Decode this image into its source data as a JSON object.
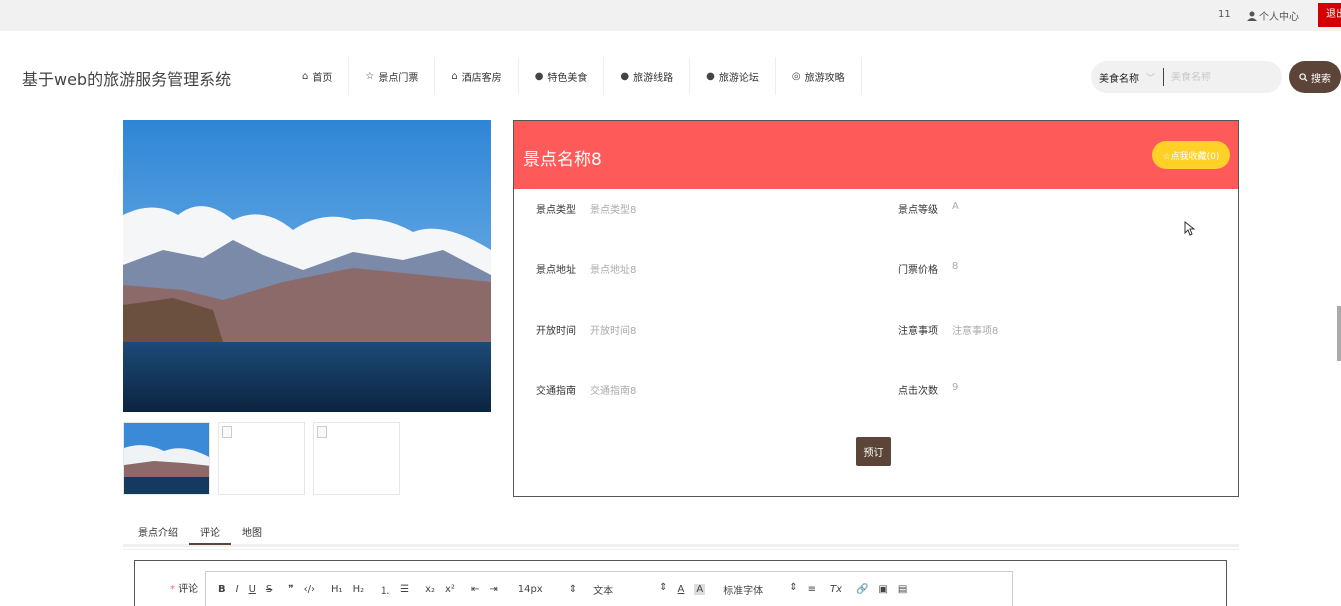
{
  "topbar": {
    "count": "11",
    "user_center": "个人中心",
    "logout": "退出"
  },
  "header": {
    "logo": "基于web的旅游服务管理系统",
    "nav": [
      {
        "label": "首页",
        "icon": "home-icon",
        "glyph": "⌂"
      },
      {
        "label": "景点门票",
        "icon": "star-icon",
        "glyph": "☆"
      },
      {
        "label": "酒店客房",
        "icon": "bag-icon",
        "glyph": "⌂"
      },
      {
        "label": "特色美食",
        "icon": "info-icon",
        "glyph": "●"
      },
      {
        "label": "旅游线路",
        "icon": "question-icon",
        "glyph": "●"
      },
      {
        "label": "旅游论坛",
        "icon": "info-icon",
        "glyph": "●"
      },
      {
        "label": "旅游攻略",
        "icon": "globe-icon",
        "glyph": "◎"
      }
    ],
    "search": {
      "select": "美食名称",
      "placeholder": "美食名称",
      "button": "搜索"
    }
  },
  "detail": {
    "title": "景点名称8",
    "fav_button": "☆点我收藏(0)",
    "fields": {
      "type": {
        "k": "景点类型",
        "v": "景点类型8"
      },
      "level": {
        "k": "景点等级",
        "v": "A"
      },
      "address": {
        "k": "景点地址",
        "v": "景点地址8"
      },
      "price": {
        "k": "门票价格",
        "v": "8"
      },
      "open": {
        "k": "开放时间",
        "v": "开放时间8"
      },
      "notice": {
        "k": "注意事项",
        "v": "注意事项8"
      },
      "traffic": {
        "k": "交通指南",
        "v": "交通指南8"
      },
      "clicks": {
        "k": "点击次数",
        "v": "9"
      }
    },
    "book_button": "预订"
  },
  "tabs": [
    {
      "label": "景点介绍",
      "active": false
    },
    {
      "label": "评论",
      "active": true
    },
    {
      "label": "地图",
      "active": false
    }
  ],
  "editor": {
    "label": "评论",
    "required_mark": "*",
    "toolbar": {
      "bold": "B",
      "italic": "I",
      "underline": "U",
      "strike": "S",
      "quote": "❞",
      "code": "‹/›",
      "h1": "H₁",
      "h2": "H₂",
      "ol": "⒈",
      "ul": "☰",
      "sub": "x₂",
      "sup": "x²",
      "outdent": "⇤",
      "indent": "⇥",
      "size": "14px",
      "format": "文本",
      "font": "标准字体",
      "color": "A",
      "bg": "A",
      "align": "≡",
      "clear": "Tx",
      "link": "🔗",
      "image": "▣",
      "video": "▤"
    }
  },
  "colors": {
    "header_red": "#ff5a5a",
    "brown": "#5d4438",
    "yellow": "#ffd028",
    "logout_red": "#d40000"
  }
}
